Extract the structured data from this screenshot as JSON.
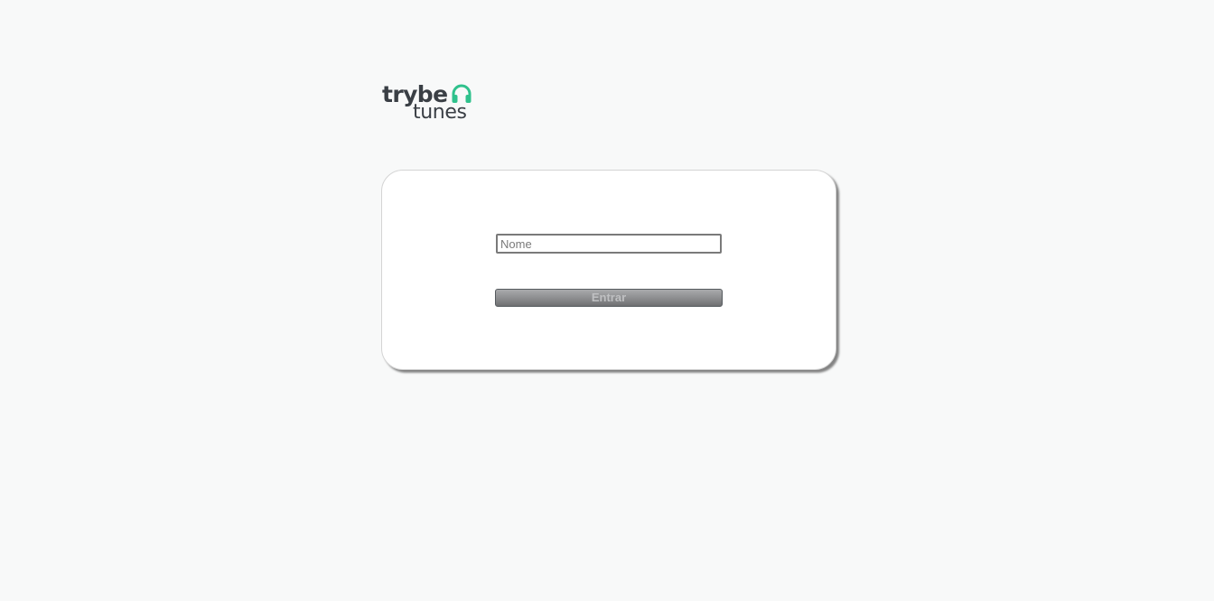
{
  "logo": {
    "line1": "trybe",
    "line2": "tunes",
    "icon": "headphones-icon",
    "accent_color": "#2fc18c",
    "text_color": "#3a3f45"
  },
  "login": {
    "name_placeholder": "Nome",
    "name_value": "",
    "submit_label": "Entrar",
    "submit_disabled": true
  }
}
